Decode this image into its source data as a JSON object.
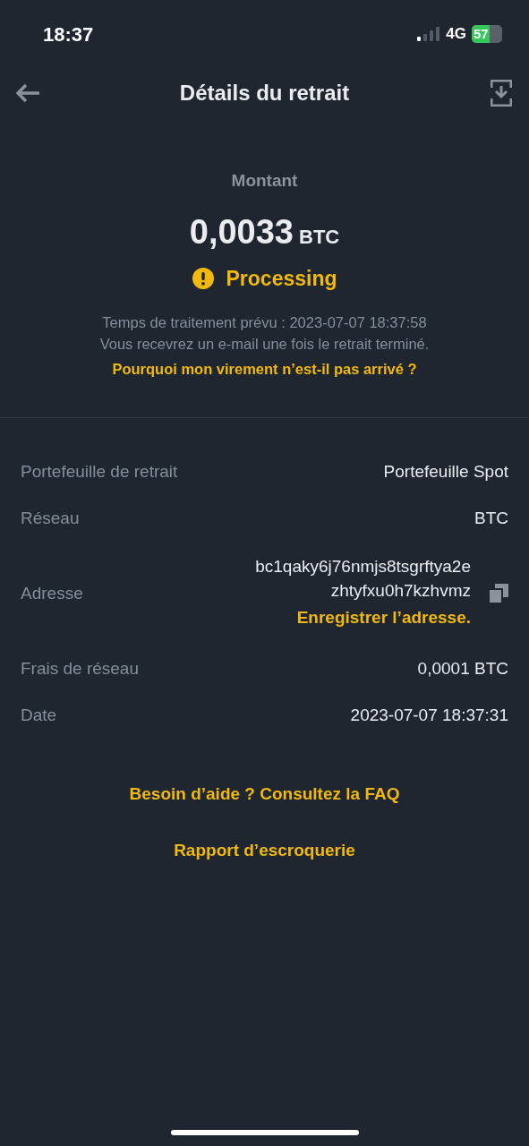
{
  "status_bar": {
    "time": "18:37",
    "network": "4G",
    "battery": "57"
  },
  "header": {
    "title": "Détails du retrait"
  },
  "amount": {
    "label": "Montant",
    "value": "0,0033",
    "unit": "BTC"
  },
  "status": {
    "kind": "warning",
    "text": "Processing"
  },
  "info": {
    "lines": [
      "Temps de traitement prévu : 2023-07-07 18:37:58",
      "Vous recevrez un e-mail une fois le retrait terminé."
    ],
    "link": "Pourquoi mon virement n’est-il pas arrivé ?"
  },
  "details": [
    {
      "kind": "text",
      "label": "Portefeuille de retrait",
      "value": "Portefeuille Spot"
    },
    {
      "kind": "text",
      "label": "Réseau",
      "value": "BTC"
    },
    {
      "kind": "address",
      "label": "Adresse",
      "lines": [
        "bc1qaky6j76nmjs8tsgrftya2e",
        "zhtyfxu0h7kzhvmz"
      ],
      "link": "Enregistrer l’adresse."
    },
    {
      "kind": "text",
      "label": "Frais de réseau",
      "value": "0,0001 BTC"
    },
    {
      "kind": "text",
      "label": "Date",
      "value": "2023-07-07 18:37:31"
    }
  ],
  "links": [
    "Besoin d’aide ? Consultez la FAQ",
    "Rapport d’escroquerie"
  ]
}
